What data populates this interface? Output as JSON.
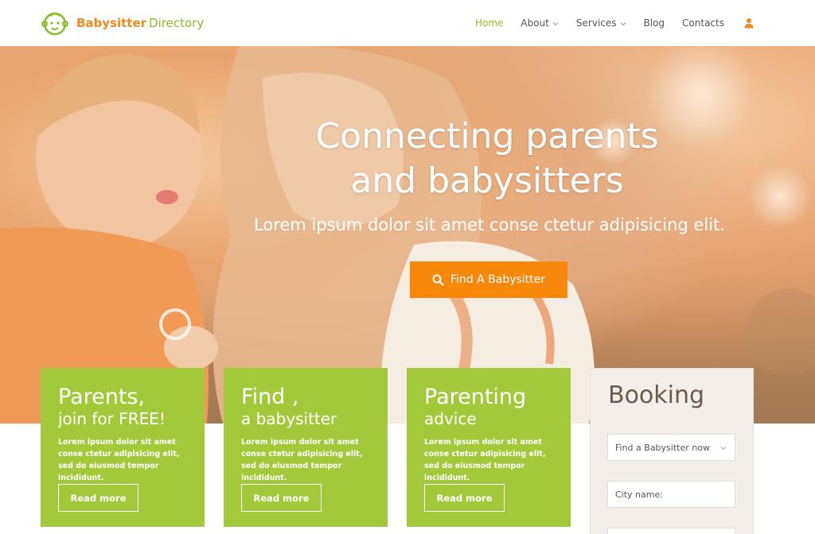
{
  "header": {
    "logo_bold": "Babysitter",
    "logo_light": "Directory",
    "nav": [
      {
        "label": "Home",
        "active": true
      },
      {
        "label": "About",
        "dropdown": true
      },
      {
        "label": "Services",
        "dropdown": true
      },
      {
        "label": "Blog"
      },
      {
        "label": "Contacts"
      }
    ],
    "user_icon": "user-icon"
  },
  "hero": {
    "title_line1": "Connecting parents",
    "title_line2": "and babysitters",
    "subtitle": "Lorem ipsum dolor sit amet conse ctetur adipisicing elit.",
    "button_label": "Find A Babysitter",
    "button_icon": "search-icon"
  },
  "cards": [
    {
      "title": "Parents,",
      "subtitle": "join for FREE!",
      "text": "Lorem ipsum dolor sit amet conse ctetur adipisicing elit, sed do eiusmod tempor incididunt.",
      "button": "Read more"
    },
    {
      "title": "Find ,",
      "subtitle": "a babysitter",
      "text": "Lorem ipsum dolor sit amet conse ctetur adipisicing elit, sed do eiusmod tempor incididunt.",
      "button": "Read more"
    },
    {
      "title": "Parenting",
      "subtitle": "advice",
      "text": "Lorem ipsum dolor sit amet conse ctetur adipisicing elit, sed do eiusmod tempor incididunt.",
      "button": "Read more"
    }
  ],
  "booking": {
    "title": "Booking",
    "select_value": "Find a Babysitter now",
    "city_placeholder": "City name:"
  },
  "colors": {
    "brand_orange": "#f8880c",
    "brand_green": "#a3c93a",
    "booking_bg": "#f3eee9"
  }
}
